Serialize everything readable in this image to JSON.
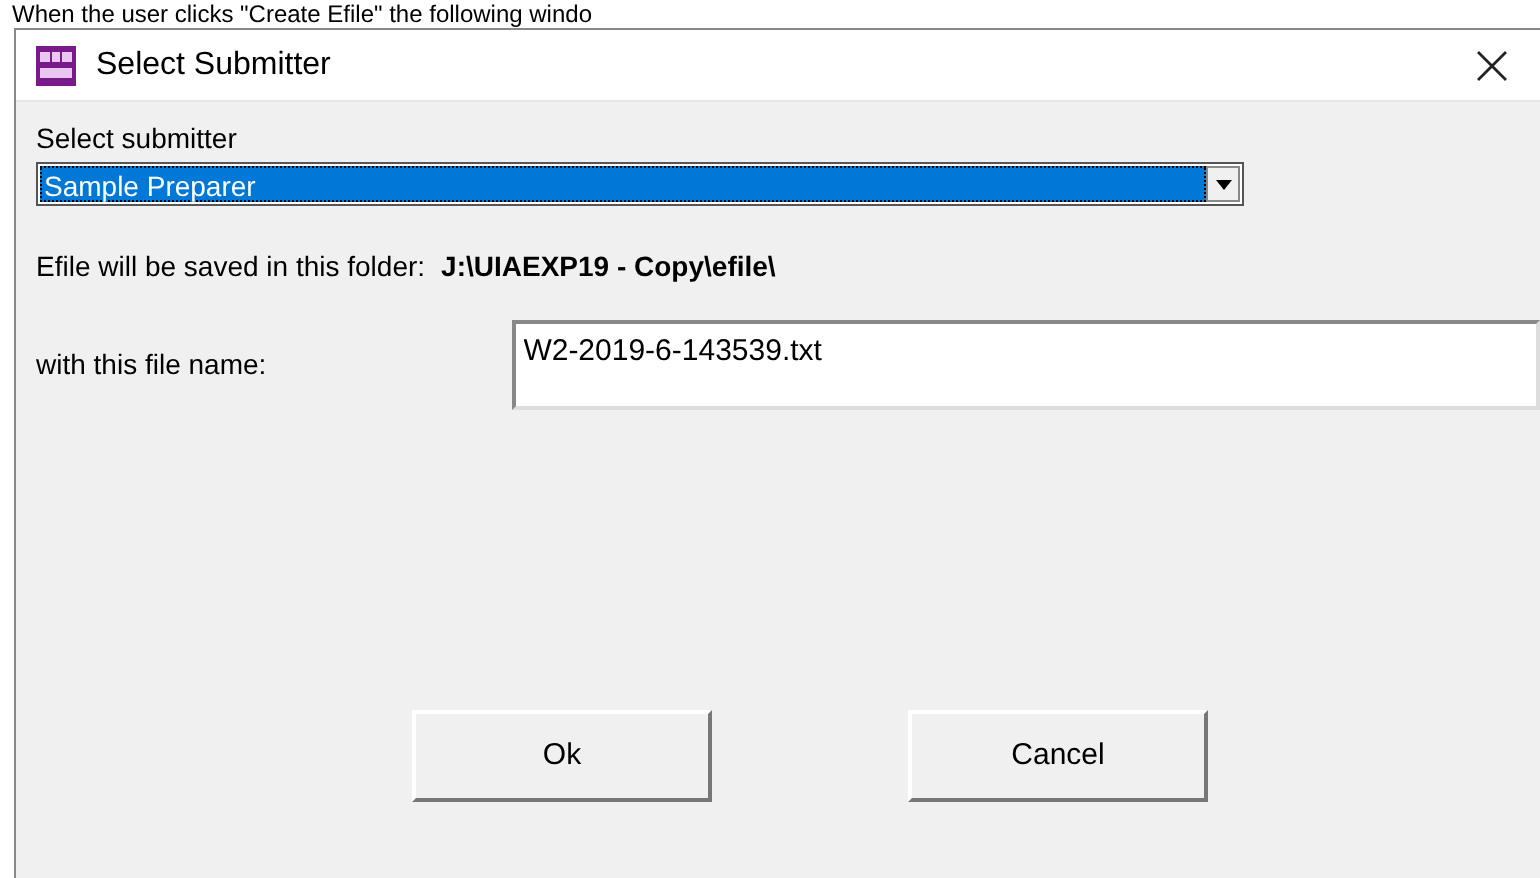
{
  "caption": "When the user clicks \"Create Efile\" the following windo",
  "window": {
    "title": "Select Submitter"
  },
  "submitter": {
    "label": "Select submitter",
    "value": "Sample Preparer",
    "selected": true
  },
  "folder": {
    "label": "Efile will be saved in this folder:",
    "path": "J:\\UIAEXP19 - Copy\\efile\\"
  },
  "file_name": {
    "label": "with this file name:",
    "value": "W2-2019-6-143539.txt"
  },
  "buttons": [
    {
      "label": "Ok"
    },
    {
      "label": "Cancel"
    }
  ]
}
